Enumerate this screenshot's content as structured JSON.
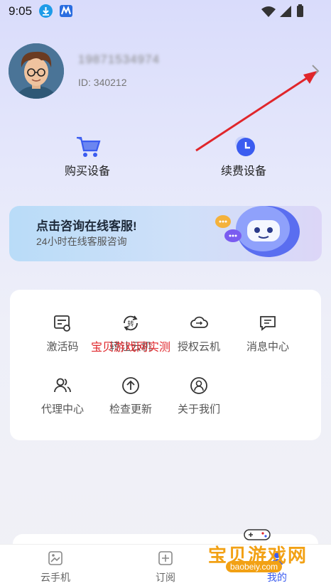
{
  "status_bar": {
    "time": "9:05"
  },
  "profile": {
    "username": "19871534974",
    "id_text": "ID: 340212"
  },
  "actions": [
    {
      "label": "购买设备",
      "icon": "cart-icon"
    },
    {
      "label": "续费设备",
      "icon": "clock-icon"
    }
  ],
  "banner": {
    "title": "点击咨询在线客服!",
    "subtitle": "24小时在线客服咨询"
  },
  "menu": [
    {
      "label": "激活码",
      "icon": "activation-code-icon"
    },
    {
      "label": "转让云机",
      "icon": "transfer-icon"
    },
    {
      "label": "授权云机",
      "icon": "cloud-authorize-icon"
    },
    {
      "label": "消息中心",
      "icon": "message-icon"
    },
    {
      "label": "代理中心",
      "icon": "agent-icon"
    },
    {
      "label": "检查更新",
      "icon": "update-icon"
    },
    {
      "label": "关于我们",
      "icon": "about-icon"
    }
  ],
  "watermark": {
    "text": "宝贝游戏网实测",
    "site_name": "宝贝游戏网",
    "site_url": "baobeiy.com"
  },
  "tabs": [
    {
      "label": "云手机",
      "icon": "cloud-phone-icon"
    },
    {
      "label": "订阅",
      "icon": "subscribe-icon"
    },
    {
      "label": "我的",
      "icon": "profile-icon"
    }
  ],
  "colors": {
    "accent": "#3b5cf0",
    "red_arrow": "#e0262b",
    "watermark_orange": "#f2a114"
  }
}
